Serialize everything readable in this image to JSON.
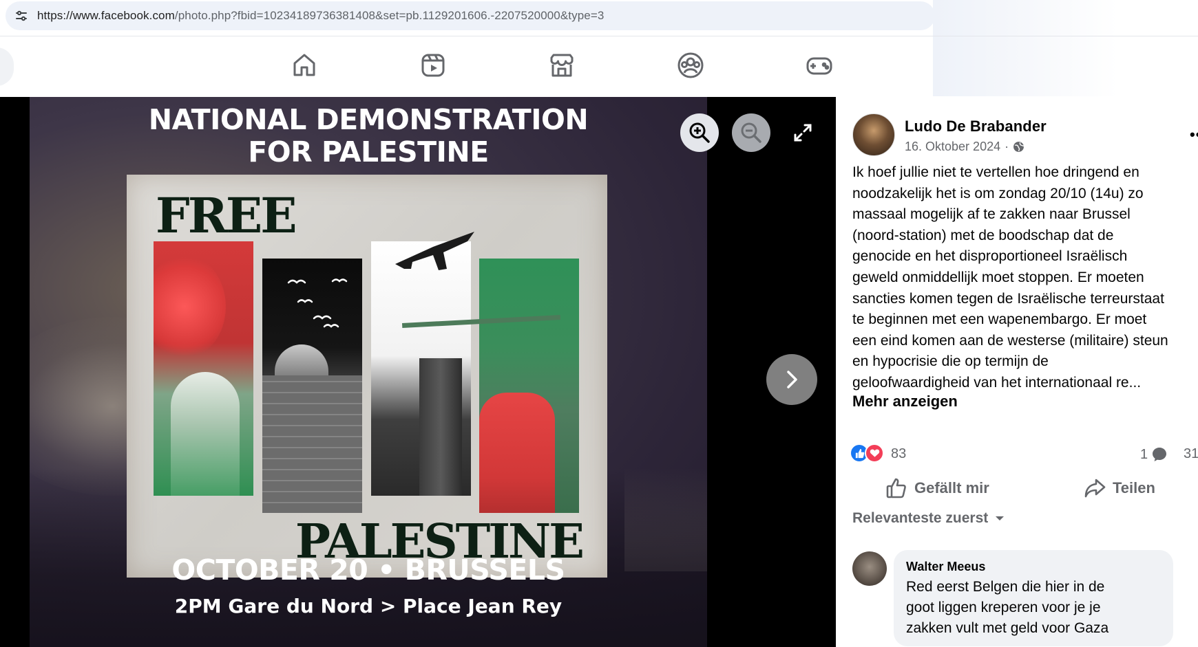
{
  "browser": {
    "url_main": "https://www.facebook.com",
    "url_rest": "/photo.php?fbid=10234189736381408&set=pb.1129201606.-2207520000&type=3"
  },
  "nav": {
    "items": [
      "home-icon",
      "video-icon",
      "marketplace-icon",
      "groups-icon",
      "gaming-icon"
    ]
  },
  "poster": {
    "title_line1": "NATIONAL DEMONSTRATION",
    "title_line2": "FOR PALESTINE",
    "word_free": "FREE",
    "word_palestine": "PALESTINE",
    "date_line": "OCTOBER 20 • BRUSSELS",
    "location_line": "2PM Gare du Nord > Place Jean Rey"
  },
  "post": {
    "author": "Ludo De Brabander",
    "date": "16. Oktober 2024",
    "privacy_icon": "globe-icon",
    "more": "•••",
    "text_lines": [
      "Ik hoef jullie niet te vertellen hoe dringend en",
      "noodzakelijk het is om zondag 20/10 (14u) zo",
      "massaal mogelijk af te zakken naar Brussel",
      "(noord-station) met de boodschap dat de",
      "genocide en het disproportioneel Israëlisch",
      "geweld onmiddellijk moet stoppen. Er moeten",
      "sancties komen tegen de Israëlische terreurstaat",
      "te beginnen met een wapenembargo. Er moet",
      "een eind komen aan de westerse (militaire) steun",
      "en hypocrisie die op termijn de",
      "geloofwaardigheid van het internationaal re..."
    ],
    "see_more": "Mehr anzeigen",
    "reaction_count": "83",
    "comment_count": "1",
    "share_count": "31",
    "like_label": "Gefällt mir",
    "share_label": "Teilen",
    "sort_label": "Relevanteste zuerst"
  },
  "comment": {
    "name": "Walter Meeus",
    "lines": [
      "Red eerst Belgen die hier in de",
      "goot liggen kreperen voor je je",
      "zakken vult met geld voor Gaza"
    ]
  },
  "colors": {
    "fb_blue": "#1877f2",
    "love_red": "#f33e58",
    "secondary_text": "#65676b",
    "comment_bg": "#f0f2f5"
  }
}
